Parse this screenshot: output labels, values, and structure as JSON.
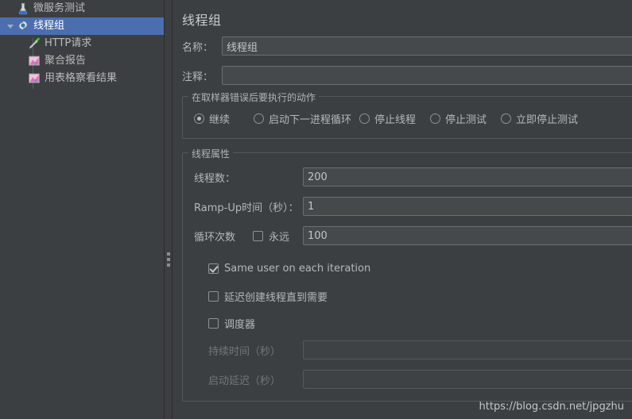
{
  "tree": {
    "items": [
      {
        "label": "微服务测试",
        "icon": "test-plan-flask-icon",
        "depth": 0,
        "selected": false,
        "expandable": false
      },
      {
        "label": "线程组",
        "icon": "thread-group-gear-icon",
        "depth": 1,
        "selected": true,
        "expandable": true
      },
      {
        "label": "HTTP请求",
        "icon": "http-request-pipette-icon",
        "depth": 2,
        "selected": false,
        "expandable": false
      },
      {
        "label": "聚合报告",
        "icon": "aggregate-report-chart-icon",
        "depth": 2,
        "selected": false,
        "expandable": false
      },
      {
        "label": "用表格察看结果",
        "icon": "view-results-table-chart-icon",
        "depth": 2,
        "selected": false,
        "expandable": false
      }
    ]
  },
  "panel": {
    "title": "线程组",
    "name_label": "名称：",
    "name_value": "线程组",
    "comment_label": "注释：",
    "comment_value": "",
    "comment_placeholder": ""
  },
  "error_action": {
    "group_title": "在取样器错误后要执行的动作",
    "options": [
      {
        "label": "继续",
        "checked": true
      },
      {
        "label": "启动下一进程循环",
        "checked": false
      },
      {
        "label": "停止线程",
        "checked": false
      },
      {
        "label": "停止测试",
        "checked": false
      },
      {
        "label": "立即停止测试",
        "checked": false
      }
    ]
  },
  "thread_properties": {
    "group_title": "线程属性",
    "threads_label": "线程数：",
    "threads_value": "200",
    "rampup_label": "Ramp-Up时间（秒）：",
    "rampup_value": "1",
    "loops_label": "循环次数",
    "forever_label": "永远",
    "forever_checked": false,
    "loops_value": "100",
    "checkboxes": [
      {
        "label": "Same user on each iteration",
        "checked": true
      },
      {
        "label": "延迟创建线程直到需要",
        "checked": false
      },
      {
        "label": "调度器",
        "checked": false
      }
    ],
    "duration_label": "持续时间（秒）",
    "duration_value": "",
    "duration_disabled": true,
    "startup_delay_label": "启动延迟（秒）",
    "startup_delay_value": "",
    "startup_delay_disabled": true
  },
  "watermark": {
    "text": "https://blog.csdn.net/jpgzhu"
  },
  "colors": {
    "window_bg": "#3c3f41",
    "selection_blue": "#4b6eaf",
    "text": "#bbbbbb",
    "disabled_text": "#72757a",
    "border": "#555859",
    "input_bg": "#45494a",
    "input_border": "#6b6f73"
  }
}
